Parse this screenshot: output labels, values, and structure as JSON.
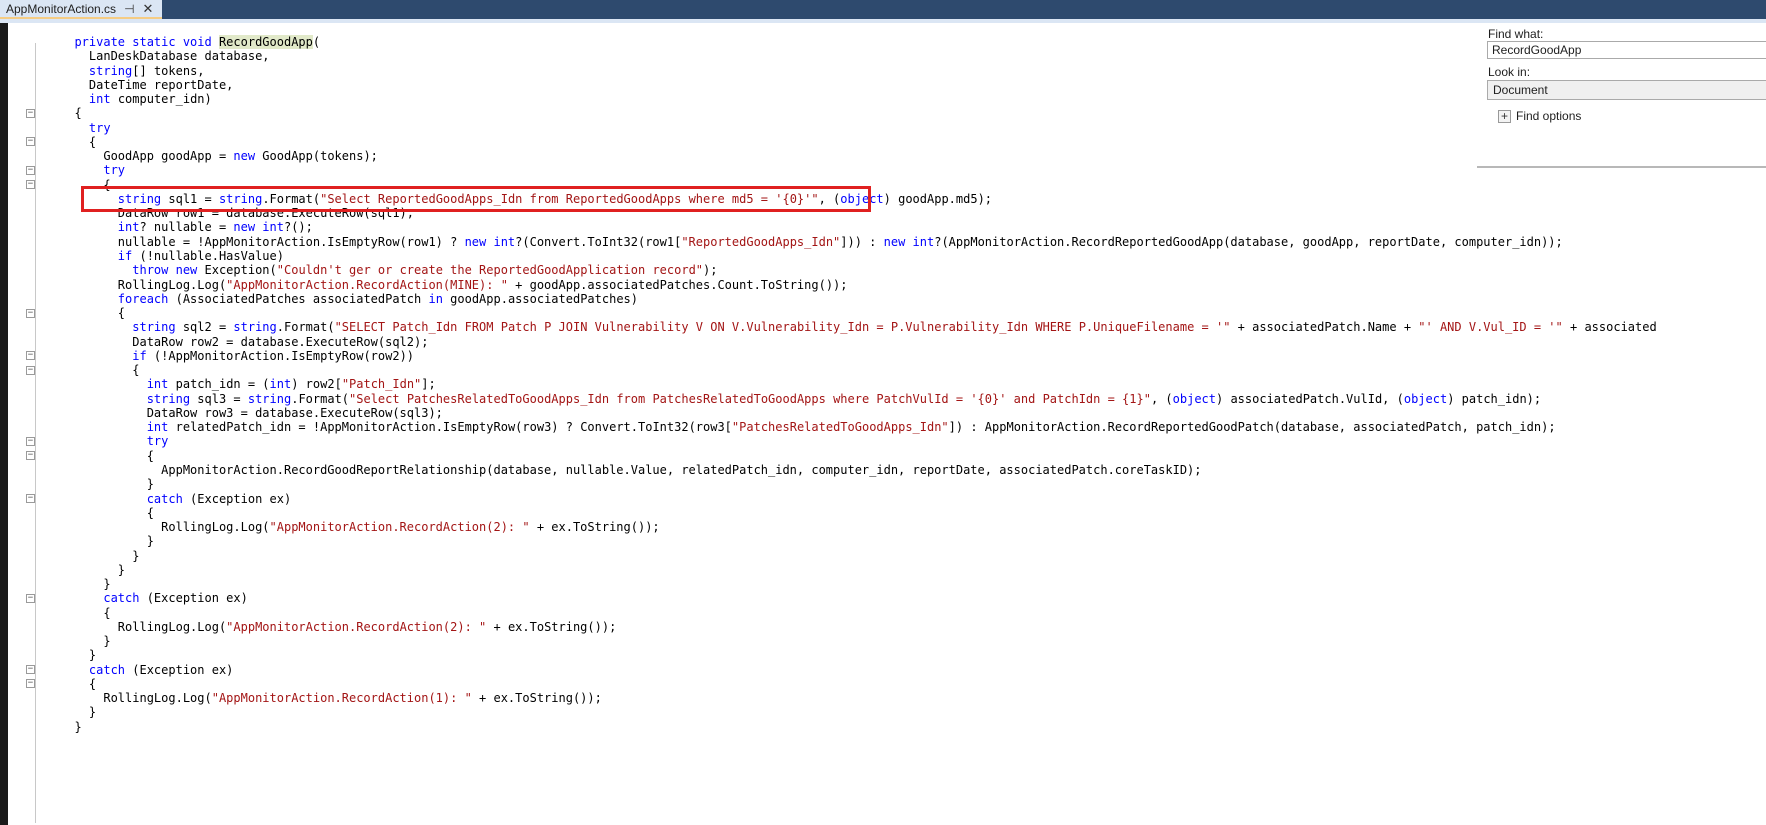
{
  "tab": {
    "filename": "AppMonitorAction.cs",
    "pin_glyph": "⊣",
    "close_glyph": "✕"
  },
  "find_panel": {
    "find_label": "Find what:",
    "find_value": "RecordGoodApp",
    "lookin_label": "Look in:",
    "lookin_value": "Document",
    "expander_glyph": "+",
    "options_label": "Find options"
  },
  "code_lines": [
    [
      {
        "t": "  "
      },
      {
        "t": "private static void ",
        "c": "kw"
      },
      {
        "t": "RecordGoodApp",
        "c": "hl"
      },
      {
        "t": "("
      }
    ],
    [
      {
        "t": "    LanDeskDatabase database,"
      }
    ],
    [
      {
        "t": "    "
      },
      {
        "t": "string",
        "c": "kw"
      },
      {
        "t": "[] tokens,"
      }
    ],
    [
      {
        "t": "    DateTime reportDate,"
      }
    ],
    [
      {
        "t": "    "
      },
      {
        "t": "int",
        "c": "kw"
      },
      {
        "t": " computer_idn)"
      }
    ],
    [
      {
        "t": "  {"
      }
    ],
    [
      {
        "t": "    "
      },
      {
        "t": "try",
        "c": "kw"
      }
    ],
    [
      {
        "t": "    {"
      }
    ],
    [
      {
        "t": "      GoodApp goodApp = "
      },
      {
        "t": "new",
        "c": "kw"
      },
      {
        "t": " GoodApp(tokens);"
      }
    ],
    [
      {
        "t": "      "
      },
      {
        "t": "try",
        "c": "kw"
      }
    ],
    [
      {
        "t": "      {"
      }
    ],
    [
      {
        "t": "        "
      },
      {
        "t": "string",
        "c": "kw"
      },
      {
        "t": " sql1 = "
      },
      {
        "t": "string",
        "c": "kw"
      },
      {
        "t": ".Format("
      },
      {
        "t": "\"Select ReportedGoodApps_Idn from ReportedGoodApps where md5 = '{0}'\"",
        "c": "st"
      },
      {
        "t": ", ("
      },
      {
        "t": "object",
        "c": "kw"
      },
      {
        "t": ") goodApp.md5);"
      }
    ],
    [
      {
        "t": "        DataRow row1 = database.ExecuteRow(sql1);"
      }
    ],
    [
      {
        "t": "        "
      },
      {
        "t": "int",
        "c": "kw"
      },
      {
        "t": "? nullable = "
      },
      {
        "t": "new int",
        "c": "kw"
      },
      {
        "t": "?();"
      }
    ],
    [
      {
        "t": "        nullable = !AppMonitorAction.IsEmptyRow(row1) ? "
      },
      {
        "t": "new int",
        "c": "kw"
      },
      {
        "t": "?(Convert.ToInt32(row1["
      },
      {
        "t": "\"ReportedGoodApps_Idn\"",
        "c": "st"
      },
      {
        "t": "])) : "
      },
      {
        "t": "new int",
        "c": "kw"
      },
      {
        "t": "?(AppMonitorAction.RecordReportedGoodApp(database, goodApp, reportDate, computer_idn));"
      }
    ],
    [
      {
        "t": "        "
      },
      {
        "t": "if",
        "c": "kw"
      },
      {
        "t": " (!nullable.HasValue)"
      }
    ],
    [
      {
        "t": "          "
      },
      {
        "t": "throw new",
        "c": "kw"
      },
      {
        "t": " Exception("
      },
      {
        "t": "\"Couldn't ger or create the ReportedGoodApplication record\"",
        "c": "st"
      },
      {
        "t": ");"
      }
    ],
    [
      {
        "t": "        RollingLog.Log("
      },
      {
        "t": "\"AppMonitorAction.RecordAction(MINE): \"",
        "c": "st"
      },
      {
        "t": " + goodApp.associatedPatches.Count.ToString());"
      }
    ],
    [
      {
        "t": "        "
      },
      {
        "t": "foreach",
        "c": "kw"
      },
      {
        "t": " (AssociatedPatches associatedPatch "
      },
      {
        "t": "in",
        "c": "kw"
      },
      {
        "t": " goodApp.associatedPatches)"
      }
    ],
    [
      {
        "t": "        {"
      }
    ],
    [
      {
        "t": "          "
      },
      {
        "t": "string",
        "c": "kw"
      },
      {
        "t": " sql2 = "
      },
      {
        "t": "string",
        "c": "kw"
      },
      {
        "t": ".Format("
      },
      {
        "t": "\"SELECT Patch_Idn FROM Patch P JOIN Vulnerability V ON V.Vulnerability_Idn = P.Vulnerability_Idn WHERE P.UniqueFilename = '\"",
        "c": "st"
      },
      {
        "t": " + associatedPatch.Name + "
      },
      {
        "t": "\"' AND V.Vul_ID = '\"",
        "c": "st"
      },
      {
        "t": " + associatedPatch.VulId + "
      },
      {
        "t": "\"'\"",
        "c": "st"
      },
      {
        "t": ");"
      }
    ],
    [
      {
        "t": "          DataRow row2 = database.ExecuteRow(sql2);"
      }
    ],
    [
      {
        "t": "          "
      },
      {
        "t": "if",
        "c": "kw"
      },
      {
        "t": " (!AppMonitorAction.IsEmptyRow(row2))"
      }
    ],
    [
      {
        "t": "          {"
      }
    ],
    [
      {
        "t": "            "
      },
      {
        "t": "int",
        "c": "kw"
      },
      {
        "t": " patch_idn = ("
      },
      {
        "t": "int",
        "c": "kw"
      },
      {
        "t": ") row2["
      },
      {
        "t": "\"Patch_Idn\"",
        "c": "st"
      },
      {
        "t": "];"
      }
    ],
    [
      {
        "t": "            "
      },
      {
        "t": "string",
        "c": "kw"
      },
      {
        "t": " sql3 = "
      },
      {
        "t": "string",
        "c": "kw"
      },
      {
        "t": ".Format("
      },
      {
        "t": "\"Select PatchesRelatedToGoodApps_Idn from PatchesRelatedToGoodApps where PatchVulId = '{0}' and PatchIdn = {1}\"",
        "c": "st"
      },
      {
        "t": ", ("
      },
      {
        "t": "object",
        "c": "kw"
      },
      {
        "t": ") associatedPatch.VulId, ("
      },
      {
        "t": "object",
        "c": "kw"
      },
      {
        "t": ") patch_idn);"
      }
    ],
    [
      {
        "t": "            DataRow row3 = database.ExecuteRow(sql3);"
      }
    ],
    [
      {
        "t": "            "
      },
      {
        "t": "int",
        "c": "kw"
      },
      {
        "t": " relatedPatch_idn = !AppMonitorAction.IsEmptyRow(row3) ? Convert.ToInt32(row3["
      },
      {
        "t": "\"PatchesRelatedToGoodApps_Idn\"",
        "c": "st"
      },
      {
        "t": "]) : AppMonitorAction.RecordReportedGoodPatch(database, associatedPatch, patch_idn);"
      }
    ],
    [
      {
        "t": "            "
      },
      {
        "t": "try",
        "c": "kw"
      }
    ],
    [
      {
        "t": "            {"
      }
    ],
    [
      {
        "t": "              AppMonitorAction.RecordGoodReportRelationship(database, nullable.Value, relatedPatch_idn, computer_idn, reportDate, associatedPatch.coreTaskID);"
      }
    ],
    [
      {
        "t": "            }"
      }
    ],
    [
      {
        "t": "            "
      },
      {
        "t": "catch",
        "c": "kw"
      },
      {
        "t": " (Exception ex)"
      }
    ],
    [
      {
        "t": "            {"
      }
    ],
    [
      {
        "t": "              RollingLog.Log("
      },
      {
        "t": "\"AppMonitorAction.RecordAction(2): \"",
        "c": "st"
      },
      {
        "t": " + ex.ToString());"
      }
    ],
    [
      {
        "t": "            }"
      }
    ],
    [
      {
        "t": "          }"
      }
    ],
    [
      {
        "t": "        }"
      }
    ],
    [
      {
        "t": "      }"
      }
    ],
    [
      {
        "t": "      "
      },
      {
        "t": "catch",
        "c": "kw"
      },
      {
        "t": " (Exception ex)"
      }
    ],
    [
      {
        "t": "      {"
      }
    ],
    [
      {
        "t": "        RollingLog.Log("
      },
      {
        "t": "\"AppMonitorAction.RecordAction(2): \"",
        "c": "st"
      },
      {
        "t": " + ex.ToString());"
      }
    ],
    [
      {
        "t": "      }"
      }
    ],
    [
      {
        "t": "    }"
      }
    ],
    [
      {
        "t": "    "
      },
      {
        "t": "catch",
        "c": "kw"
      },
      {
        "t": " (Exception ex)"
      }
    ],
    [
      {
        "t": "    {"
      }
    ],
    [
      {
        "t": "      RollingLog.Log("
      },
      {
        "t": "\"AppMonitorAction.RecordAction(1): \"",
        "c": "st"
      },
      {
        "t": " + ex.ToString());"
      }
    ],
    [
      {
        "t": "    }"
      }
    ],
    [
      {
        "t": "  }"
      }
    ]
  ]
}
